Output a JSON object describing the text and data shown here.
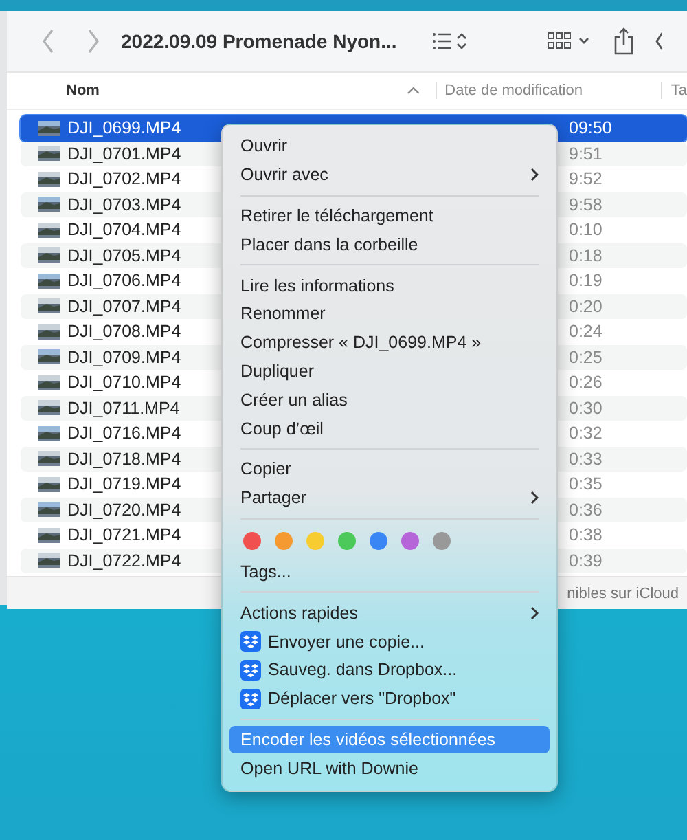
{
  "window": {
    "title": "2022.09.09 Promenade Nyon..."
  },
  "table": {
    "columns": [
      "Nom",
      "Date de modification",
      "Ta"
    ],
    "rows": [
      {
        "name": "DJI_0699.MP4",
        "date": "09:50",
        "selected": true
      },
      {
        "name": "DJI_0701.MP4",
        "date": "9:51",
        "selected": false
      },
      {
        "name": "DJI_0702.MP4",
        "date": "9:52",
        "selected": false
      },
      {
        "name": "DJI_0703.MP4",
        "date": "9:58",
        "selected": false
      },
      {
        "name": "DJI_0704.MP4",
        "date": "0:10",
        "selected": false
      },
      {
        "name": "DJI_0705.MP4",
        "date": "0:18",
        "selected": false
      },
      {
        "name": "DJI_0706.MP4",
        "date": "0:19",
        "selected": false
      },
      {
        "name": "DJI_0707.MP4",
        "date": "0:20",
        "selected": false
      },
      {
        "name": "DJI_0708.MP4",
        "date": "0:24",
        "selected": false
      },
      {
        "name": "DJI_0709.MP4",
        "date": "0:25",
        "selected": false
      },
      {
        "name": "DJI_0710.MP4",
        "date": "0:26",
        "selected": false
      },
      {
        "name": "DJI_0711.MP4",
        "date": "0:30",
        "selected": false
      },
      {
        "name": "DJI_0716.MP4",
        "date": "0:32",
        "selected": false
      },
      {
        "name": "DJI_0718.MP4",
        "date": "0:33",
        "selected": false
      },
      {
        "name": "DJI_0719.MP4",
        "date": "0:35",
        "selected": false
      },
      {
        "name": "DJI_0720.MP4",
        "date": "0:36",
        "selected": false
      },
      {
        "name": "DJI_0721.MP4",
        "date": "0:38",
        "selected": false
      },
      {
        "name": "DJI_0722.MP4",
        "date": "0:39",
        "selected": false
      }
    ]
  },
  "status_bar": "nibles sur iCloud",
  "context_menu": {
    "items": [
      {
        "kind": "item",
        "label": "Ouvrir",
        "submenu": false,
        "selected": false
      },
      {
        "kind": "item",
        "label": "Ouvrir avec",
        "submenu": true,
        "selected": false
      },
      {
        "kind": "separator"
      },
      {
        "kind": "item",
        "label": "Retirer le téléchargement",
        "submenu": false,
        "selected": false
      },
      {
        "kind": "item",
        "label": "Placer dans la corbeille",
        "submenu": false,
        "selected": false
      },
      {
        "kind": "separator"
      },
      {
        "kind": "item",
        "label": "Lire les informations",
        "submenu": false,
        "selected": false
      },
      {
        "kind": "item",
        "label": "Renommer",
        "submenu": false,
        "selected": false
      },
      {
        "kind": "item",
        "label": "Compresser « DJI_0699.MP4 »",
        "submenu": false,
        "selected": false
      },
      {
        "kind": "item",
        "label": "Dupliquer",
        "submenu": false,
        "selected": false
      },
      {
        "kind": "item",
        "label": "Créer un alias",
        "submenu": false,
        "selected": false
      },
      {
        "kind": "item",
        "label": "Coup d’œil",
        "submenu": false,
        "selected": false
      },
      {
        "kind": "separator"
      },
      {
        "kind": "item",
        "label": "Copier",
        "submenu": false,
        "selected": false
      },
      {
        "kind": "item",
        "label": "Partager",
        "submenu": true,
        "selected": false
      },
      {
        "kind": "separator"
      },
      {
        "kind": "tags",
        "tags": [
          {
            "color": "#f05050"
          },
          {
            "color": "#f59a30"
          },
          {
            "color": "#f7cc30"
          },
          {
            "color": "#4cc95a"
          },
          {
            "color": "#3a86f5"
          },
          {
            "color": "#b565d8"
          },
          {
            "color": "#999999"
          }
        ]
      },
      {
        "kind": "item",
        "label": "Tags...",
        "submenu": false,
        "selected": false
      },
      {
        "kind": "separator"
      },
      {
        "kind": "item",
        "label": "Actions rapides",
        "submenu": true,
        "selected": false
      },
      {
        "kind": "dropbox",
        "label": "Envoyer une copie...",
        "selected": false
      },
      {
        "kind": "dropbox",
        "label": "Sauveg. dans Dropbox...",
        "selected": false
      },
      {
        "kind": "dropbox",
        "label": "Déplacer vers \"Dropbox\"",
        "selected": false
      },
      {
        "kind": "separator"
      },
      {
        "kind": "item",
        "label": "Encoder les vidéos sélectionnées",
        "submenu": false,
        "selected": true
      },
      {
        "kind": "item",
        "label": "Open URL with Downie",
        "submenu": false,
        "selected": false
      }
    ]
  }
}
